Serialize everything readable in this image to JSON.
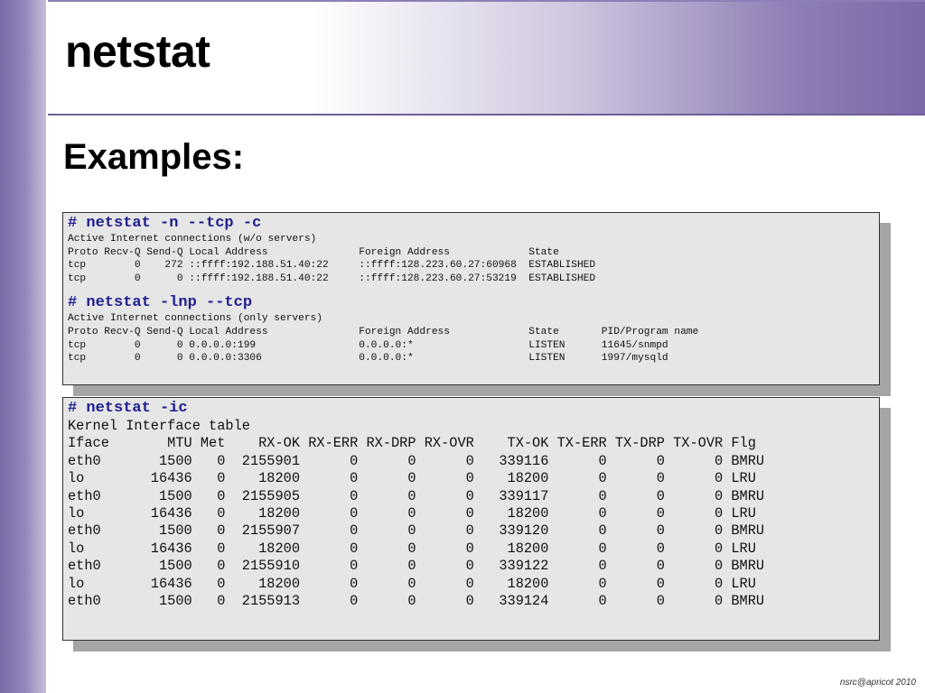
{
  "slide": {
    "title": "netstat",
    "subtitle": "Examples:",
    "footer": "nsrc@apricot 2010"
  },
  "box1": {
    "cmd1": "# netstat -n --tcp -c",
    "block1": [
      "Active Internet connections (w/o servers)",
      "Proto Recv-Q Send-Q Local Address               Foreign Address             State",
      "tcp        0    272 ::ffff:192.188.51.40:22     ::ffff:128.223.60.27:60968  ESTABLISHED",
      "tcp        0      0 ::ffff:192.188.51.40:22     ::ffff:128.223.60.27:53219  ESTABLISHED"
    ],
    "cmd2": "# netstat -lnp --tcp",
    "block2": [
      "Active Internet connections (only servers)",
      "Proto Recv-Q Send-Q Local Address               Foreign Address             State       PID/Program name",
      "tcp        0      0 0.0.0.0:199                 0.0.0.0:*                   LISTEN      11645/snmpd",
      "tcp        0      0 0.0.0.0:3306                0.0.0.0:*                   LISTEN      1997/mysqld"
    ]
  },
  "box2": {
    "cmd": "# netstat -ic",
    "lines": [
      "Kernel Interface table",
      "Iface       MTU Met    RX-OK RX-ERR RX-DRP RX-OVR    TX-OK TX-ERR TX-DRP TX-OVR Flg",
      "eth0       1500   0  2155901      0      0      0   339116      0      0      0 BMRU",
      "lo        16436   0    18200      0      0      0    18200      0      0      0 LRU",
      "eth0       1500   0  2155905      0      0      0   339117      0      0      0 BMRU",
      "lo        16436   0    18200      0      0      0    18200      0      0      0 LRU",
      "eth0       1500   0  2155907      0      0      0   339120      0      0      0 BMRU",
      "lo        16436   0    18200      0      0      0    18200      0      0      0 LRU",
      "eth0       1500   0  2155910      0      0      0   339122      0      0      0 BMRU",
      "lo        16436   0    18200      0      0      0    18200      0      0      0 LRU",
      "eth0       1500   0  2155913      0      0      0   339124      0      0      0 BMRU"
    ]
  },
  "colors": {
    "accent": "#7d69a7",
    "command": "#1f1f8f",
    "terminal_bg": "#e6e6e6",
    "shadow": "#a5a5a5"
  }
}
